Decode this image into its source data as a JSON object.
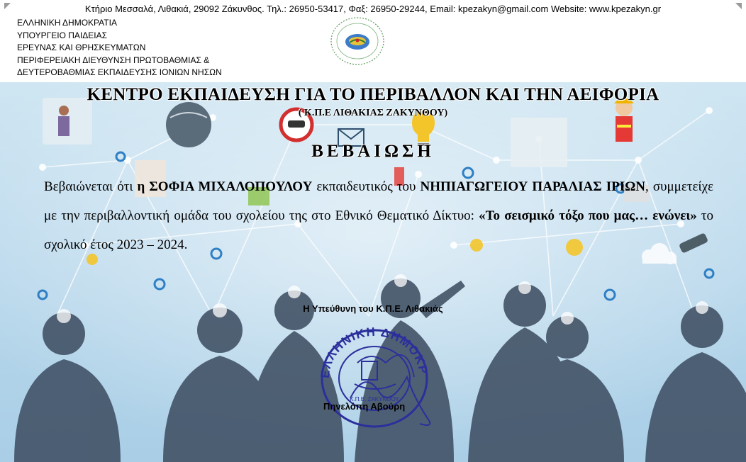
{
  "header": {
    "contact_line": "Κτήριο Μεσσαλά, Λιθακιά, 29092 Ζάκυνθος. Τηλ.: 26950-53417, Φαξ: 26950-29244, Email: kpezakyn@gmail.com  Website: www.kpezakyn.gr"
  },
  "authority": {
    "lines": [
      "ΕΛΛΗΝΙΚΗ ΔΗΜΟΚΡΑΤΙΑ",
      "ΥΠΟΥΡΓΕΙΟ  ΠΑΙΔΕΙΑΣ",
      "ΕΡΕΥΝΑΣ ΚΑΙ  ΘΡΗΣΚΕΥΜΑΤΩΝ",
      "ΠΕΡΙΦΕΡΕΙΑΚΗ ΔΙΕΥΘΥΝΣΗ ΠΡΩΤΟΒΑΘΜΙΑΣ &",
      "ΔΕΥΤΕΡΟΒΑΘΜΙΑΣ ΕΚΠΑΙΔΕΥΣΗΣ ΙΟΝΙΩΝ ΝΗΣΩΝ"
    ]
  },
  "certificate": {
    "title": "ΚΕΝΤΡΟ ΕΚΠΑΙΔΕΥΣΗ ΓΙΑ ΤΟ ΠΕΡΙΒΑΛΛΟΝ ΚΑΙ ΤΗΝ ΑΕΙΦΟΡΙΑ",
    "subtitle": "( Κ.Π.Ε ΛΙΘΑΚΙΑΣ ΖΑΚΥΝΘΟΥ)",
    "heading": "ΒΕΒΑΙΩΣΗ",
    "body": {
      "t1": "Βεβαιώνεται ότι ",
      "b1": "η ΣΟΦΙΑ ΜΙΧΑΛΟΠΟΥΛΟΥ",
      "t2": " εκπαιδευτικός του ",
      "b2": "ΝΗΠΙΑΓΩΓΕΙΟΥ ΠΑΡΑΛΙΑΣ ΙΡΙΩΝ",
      "t3": ", συμμετείχε με την περιβαλλοντική ομάδα του σχολείου της στο Εθνικό Θεματικό Δίκτυο: ",
      "b3": "«Το σεισμικό τόξο που μας… ενώνει»",
      "t4": " το σχολικό έτος 2023 – 2024."
    },
    "signer_role": "Η Υπεύθυνη του Κ.Π.Ε. Λιθακιάς",
    "signer_name": "Πηνελόπη Αβούρη"
  },
  "stamp": {
    "outer_text": "ΕΛΛΗΝΙΚΗ ΔΗΜΟΚΡΑΤΙΑ",
    "inner_text": "Κ.Π.Ε. ΖΑΚΥΝΘΟΥ"
  },
  "colors": {
    "stamp_ink": "#2b2f9c",
    "banner_light": "#cfe6f2",
    "silhouette": "#3f4f63"
  }
}
